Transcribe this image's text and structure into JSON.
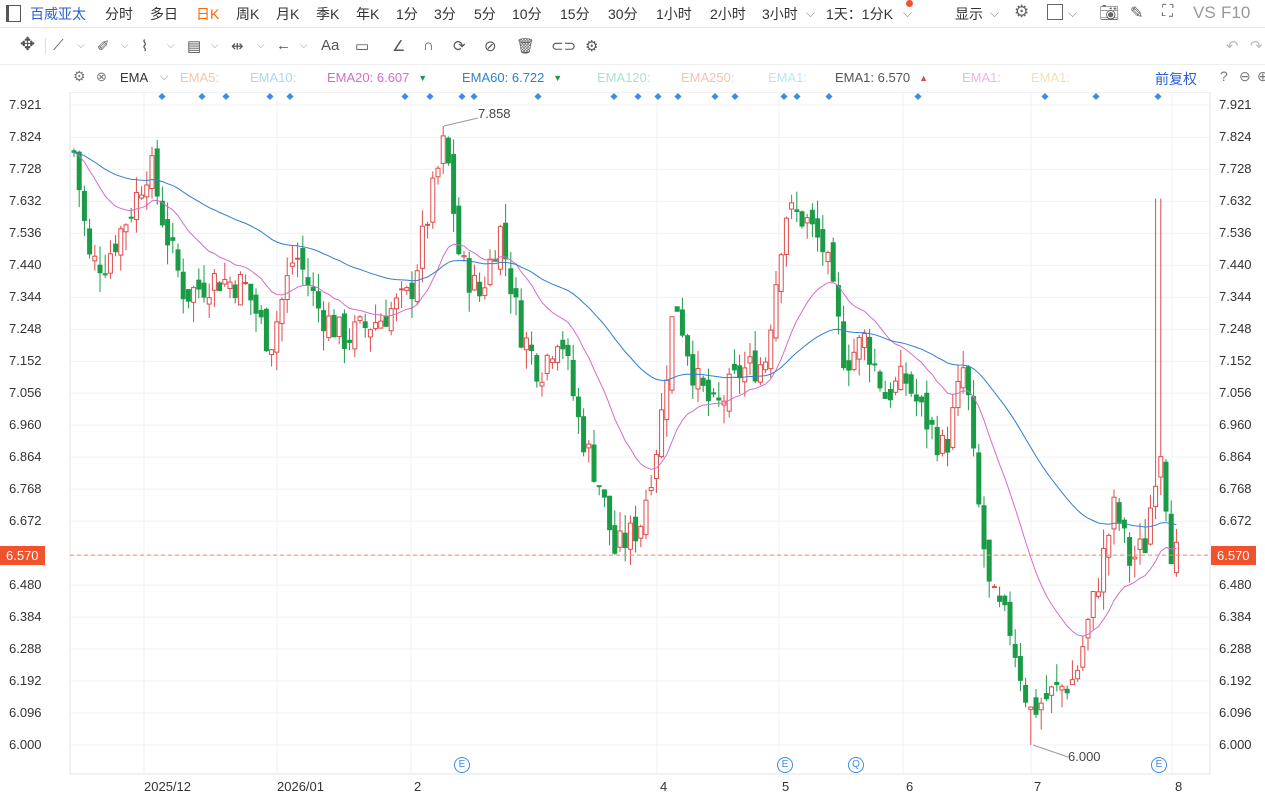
{
  "toolbar": {
    "stock_name": "百威亚太",
    "periods": [
      "分时",
      "多日",
      "日K",
      "周K",
      "月K",
      "季K",
      "年K",
      "1分",
      "3分",
      "5分",
      "10分",
      "15分",
      "30分",
      "1小时",
      "2小时",
      "3小时"
    ],
    "active_period": "日K",
    "range_label": "1天：1分K",
    "display_label": "显示",
    "vs_label": "VS",
    "f10_label": "F10"
  },
  "indicator": {
    "name": "EMA",
    "items": [
      {
        "label": "EMA5:",
        "value": "",
        "color": "#f5c6a5"
      },
      {
        "label": "EMA10:",
        "value": "",
        "color": "#a9d8ef"
      },
      {
        "label": "EMA20:",
        "value": "6.607",
        "color": "#d46ccc",
        "arrow": "down"
      },
      {
        "label": "EMA60:",
        "value": "6.722",
        "color": "#2f7fd4",
        "arrow": "down"
      },
      {
        "label": "EMA120:",
        "value": "",
        "color": "#a8e2cf"
      },
      {
        "label": "EMA250:",
        "value": "",
        "color": "#f5c0b0"
      },
      {
        "label": "EMA1:",
        "value": "",
        "color": "#b8e6f3"
      },
      {
        "label": "EMA1:",
        "value": "6.570",
        "color": "#555555",
        "arrow": "up"
      },
      {
        "label": "EMA1:",
        "value": "",
        "color": "#e9b5e3"
      },
      {
        "label": "EMA1:",
        "value": "",
        "color": "#f5dfb0"
      }
    ],
    "adjust_label": "前复权"
  },
  "chart_data": {
    "type": "candlestick",
    "y_ticks": [
      "7.921",
      "7.824",
      "7.728",
      "7.632",
      "7.536",
      "7.440",
      "7.344",
      "7.248",
      "7.152",
      "7.056",
      "6.960",
      "6.864",
      "6.768",
      "6.672",
      "6.570",
      "6.480",
      "6.384",
      "6.288",
      "6.192",
      "6.096",
      "6.000"
    ],
    "ylim": [
      6.0,
      7.921
    ],
    "x_labels": [
      "2025/12",
      "2026/01",
      "2",
      "4",
      "5",
      "6",
      "7",
      "8"
    ],
    "last_price": "6.570",
    "high_label": "7.858",
    "low_label": "6.000",
    "event_markers": [
      "E",
      "E",
      "Q",
      "E"
    ],
    "ema20_last": 6.607,
    "ema60_last": 6.722,
    "colors": {
      "up": "#e04a4a",
      "down": "#1a9b46",
      "ema20": "#d46ccc",
      "ema60": "#2f7fd4",
      "last": "#f08a5d"
    }
  }
}
